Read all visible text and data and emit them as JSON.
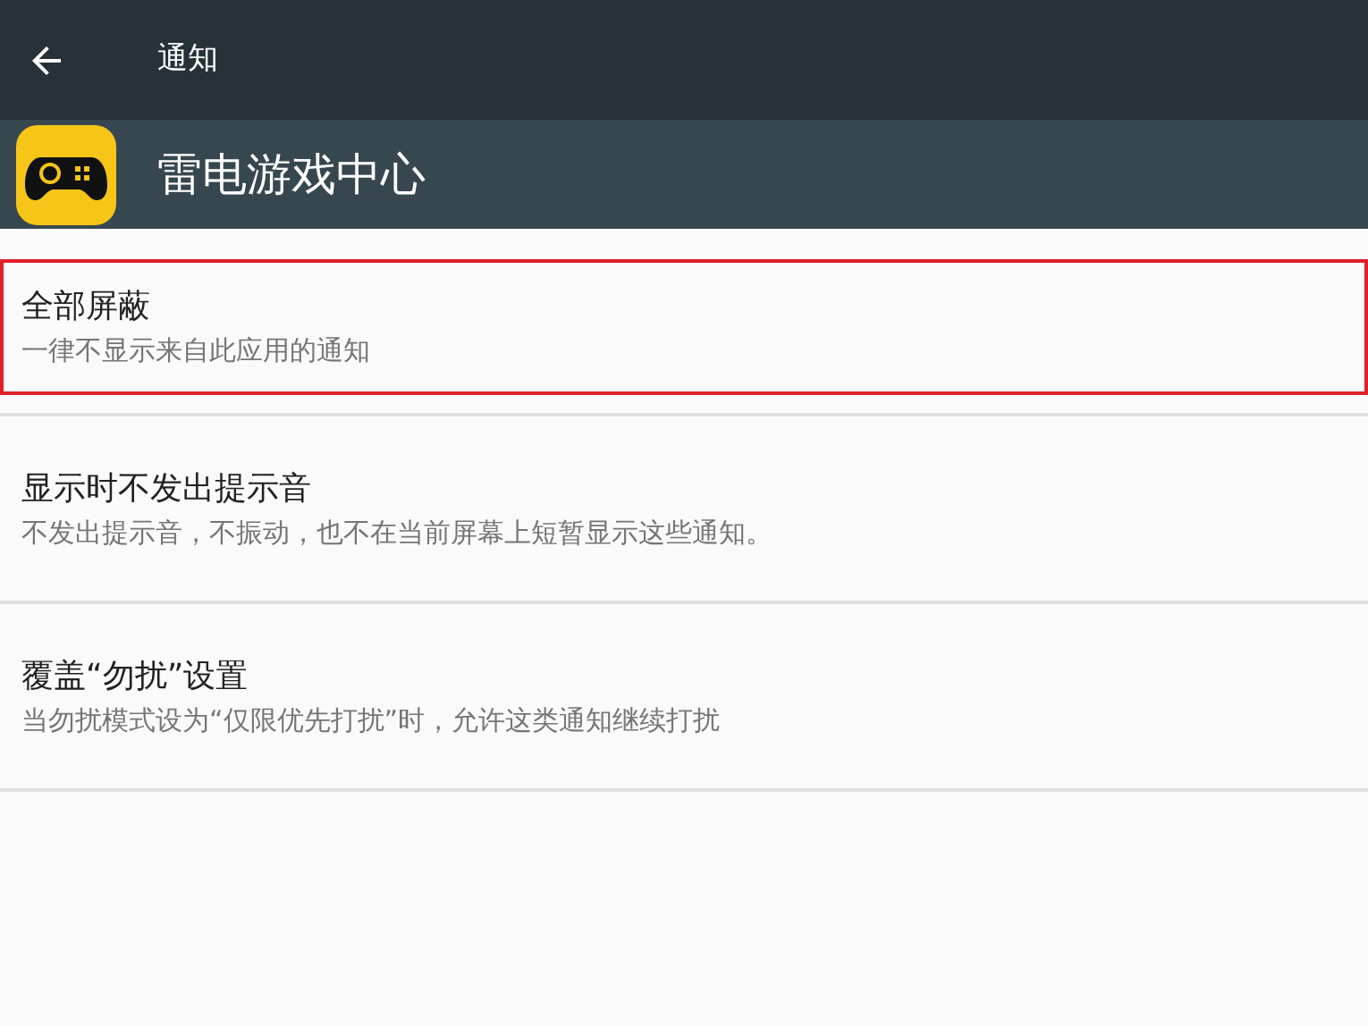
{
  "toolbar": {
    "title": "通知"
  },
  "app": {
    "name": "雷电游戏中心"
  },
  "settings": [
    {
      "title": "全部屏蔽",
      "summary": "一律不显示来自此应用的通知",
      "highlighted": true
    },
    {
      "title": "显示时不发出提示音",
      "summary": "不发出提示音，不振动，也不在当前屏幕上短暂显示这些通知。",
      "highlighted": false
    },
    {
      "title": "覆盖“勿扰”设置",
      "summary": "当勿扰模式设为“仅限优先打扰”时，允许这类通知继续打扰",
      "highlighted": false
    }
  ]
}
